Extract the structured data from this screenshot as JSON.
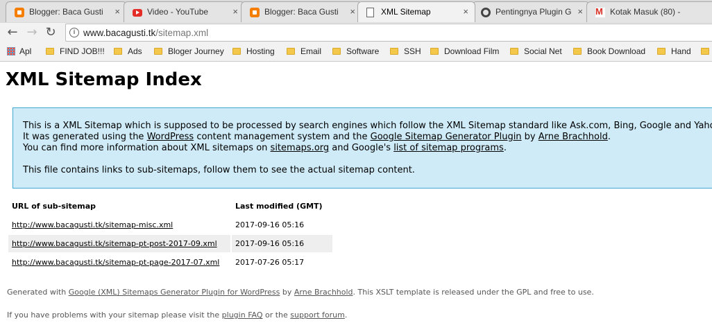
{
  "browser": {
    "tabs": [
      {
        "title": "Blogger: Baca Gusti",
        "icon": "blogger-icon"
      },
      {
        "title": "Video - YouTube",
        "icon": "youtube-icon"
      },
      {
        "title": "Blogger: Baca Gusti",
        "icon": "blogger-icon"
      },
      {
        "title": "XML Sitemap",
        "icon": "page-icon",
        "active": true
      },
      {
        "title": "Pentingnya Plugin G",
        "icon": "gear-icon"
      },
      {
        "title": "Kotak Masuk (80) -",
        "icon": "gmail-icon"
      }
    ],
    "tab_close_glyph": "×",
    "address": {
      "host": "www.bacagusti.tk",
      "path": "/sitemap.xml"
    },
    "bookmarks": [
      "Apl",
      "FIND JOB!!!",
      "Ads",
      "Bloger Journey",
      "Hosting",
      "Email",
      "Software",
      "SSH",
      "Download Film",
      "Social Net",
      "Book Download",
      "Hand"
    ]
  },
  "page": {
    "title": "XML Sitemap Index",
    "intro": {
      "line1": "This is a XML Sitemap which is supposed to be processed by search engines which follow the XML Sitemap standard like Ask.com, Bing, Google and Yahoo.",
      "line2_a": "It was generated using the ",
      "line2_link1": "WordPress",
      "line2_b": " content management system and the ",
      "line2_link2": "Google Sitemap Generator Plugin",
      "line2_c": " by ",
      "line2_link3": "Arne Brachhold",
      "line2_d": ".",
      "line3_a": "You can find more information about XML sitemaps on ",
      "line3_link1": "sitemaps.org",
      "line3_b": " and Google's ",
      "line3_link2": "list of sitemap programs",
      "line3_c": ".",
      "line4": "This file contains links to sub-sitemaps, follow them to see the actual sitemap content."
    },
    "table": {
      "headers": [
        "URL of sub-sitemap",
        "Last modified (GMT)"
      ],
      "rows": [
        {
          "url": "http://www.bacagusti.tk/sitemap-misc.xml",
          "modified": "2017-09-16 05:16"
        },
        {
          "url": "http://www.bacagusti.tk/sitemap-pt-post-2017-09.xml",
          "modified": "2017-09-16 05:16"
        },
        {
          "url": "http://www.bacagusti.tk/sitemap-pt-page-2017-07.xml",
          "modified": "2017-07-26 05:17"
        }
      ]
    },
    "footer": {
      "line1_a": "Generated with ",
      "line1_link1": "Google (XML) Sitemaps Generator Plugin for WordPress",
      "line1_b": " by ",
      "line1_link2": "Arne Brachhold",
      "line1_c": ". This XSLT template is released under the GPL and free to use.",
      "line2_a": "If you have problems with your sitemap please visit the ",
      "line2_link1": "plugin FAQ",
      "line2_b": " or the ",
      "line2_link2": "support forum",
      "line2_c": "."
    }
  }
}
